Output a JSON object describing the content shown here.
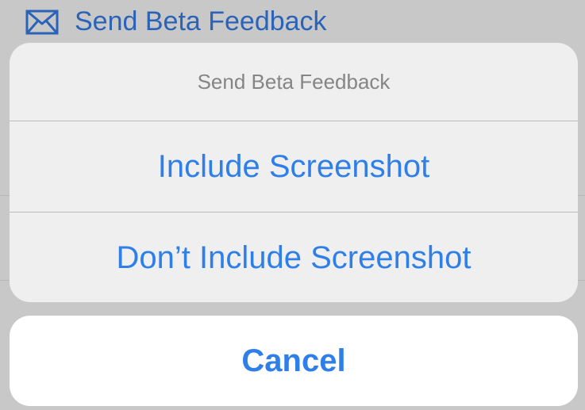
{
  "background": {
    "menu_item": {
      "icon": "envelope-icon",
      "label": "Send Beta Feedback"
    }
  },
  "action_sheet": {
    "title": "Send Beta Feedback",
    "actions": [
      {
        "label": "Include Screenshot"
      },
      {
        "label": "Don’t Include Screenshot"
      }
    ],
    "cancel_label": "Cancel"
  },
  "colors": {
    "accent": "#2f7fe8",
    "title_gray": "#858585",
    "sheet_bg": "#efefef",
    "dim_bg": "#c8c8c8"
  }
}
